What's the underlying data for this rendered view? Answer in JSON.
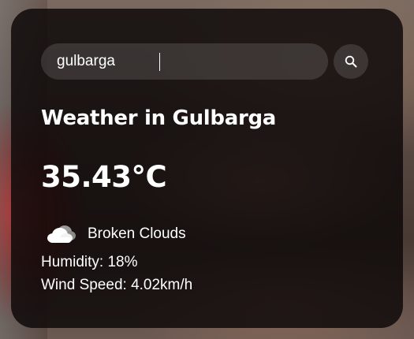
{
  "search": {
    "value": "gulbarga",
    "icon": "search-icon"
  },
  "weather": {
    "title": "Weather in Gulbarga",
    "temperature": "35.43°C",
    "condition": "Broken Clouds",
    "condition_icon": "cloud-icon",
    "humidity": "Humidity: 18%",
    "wind_speed": "Wind Speed: 4.02km/h"
  },
  "colors": {
    "card_background": "#0f0a0a",
    "text": "#ffffff"
  }
}
